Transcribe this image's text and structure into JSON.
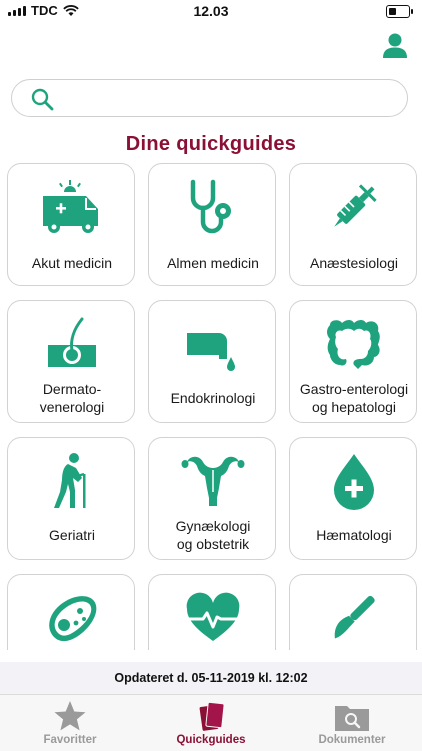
{
  "status_bar": {
    "carrier": "TDC",
    "time": "12.03"
  },
  "search": {
    "placeholder": "",
    "value": ""
  },
  "heading": "Dine quickguides",
  "colors": {
    "accent_green": "#1ea37e",
    "brand_red": "#8b1036"
  },
  "tiles": [
    {
      "label": "Akut medicin",
      "icon": "ambulance-icon"
    },
    {
      "label": "Almen medicin",
      "icon": "stethoscope-icon"
    },
    {
      "label": "Anæstesiologi",
      "icon": "syringe-icon"
    },
    {
      "label": "Dermato-\nvenerologi",
      "icon": "skin-follicle-icon"
    },
    {
      "label": "Endokrinologi",
      "icon": "drop-dispenser-icon"
    },
    {
      "label": "Gastro-enterologi\nog hepatologi",
      "icon": "intestine-icon"
    },
    {
      "label": "Geriatri",
      "icon": "elderly-person-icon"
    },
    {
      "label": "Gynækologi\nog obstetrik",
      "icon": "uterus-icon"
    },
    {
      "label": "Hæmatologi",
      "icon": "blood-drop-icon"
    },
    {
      "label": "",
      "icon": "bacteria-icon"
    },
    {
      "label": "",
      "icon": "heartbeat-icon"
    },
    {
      "label": "",
      "icon": "scalpel-icon"
    }
  ],
  "footer": {
    "updated": "Opdateret d. 05-11-2019 kl. 12:02"
  },
  "tabs": [
    {
      "label": "Favoritter",
      "icon": "star-icon",
      "active": false
    },
    {
      "label": "Quickguides",
      "icon": "quickguides-icon",
      "active": true
    },
    {
      "label": "Dokumenter",
      "icon": "folder-search-icon",
      "active": false
    }
  ]
}
